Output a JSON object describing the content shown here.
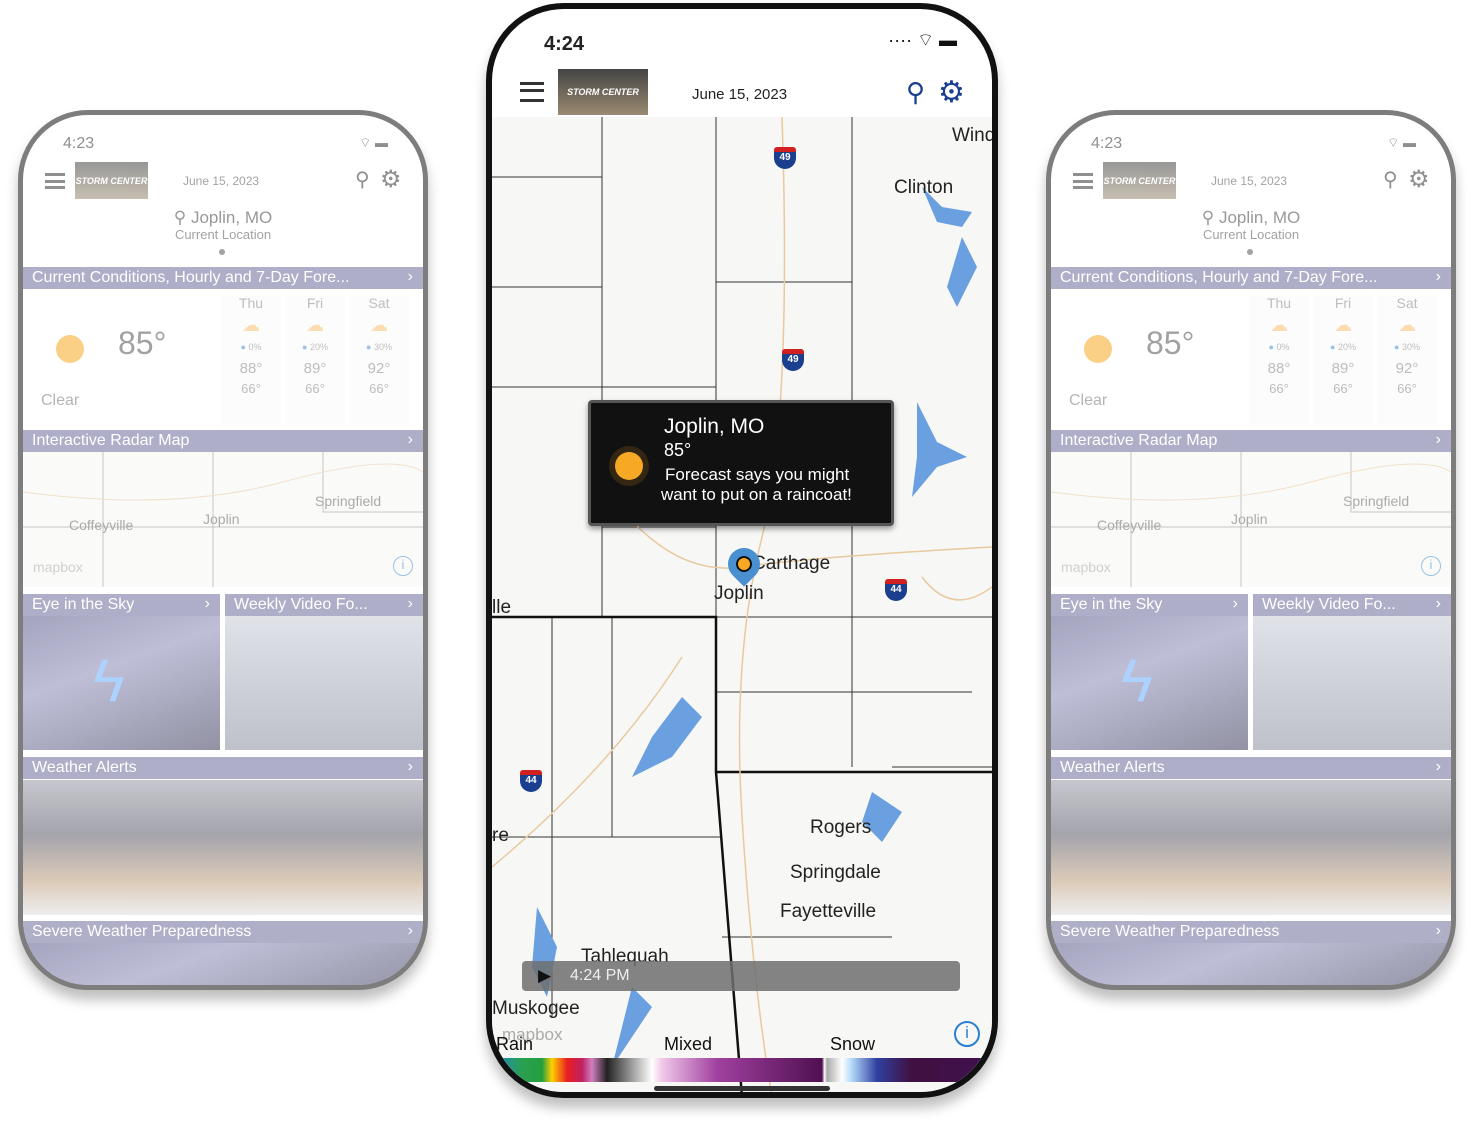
{
  "side_phone": {
    "time": "4:23",
    "date": "June 15, 2023",
    "logo": "STORM CENTER",
    "location": "Joplin, MO",
    "location_sub": "Current Location",
    "sections": {
      "conditions": "Current Conditions, Hourly and 7-Day Fore...",
      "radar": "Interactive Radar Map",
      "eye": "Eye in the Sky",
      "video": "Weekly Video Fo...",
      "alerts": "Weather Alerts",
      "severe": "Severe Weather Preparedness"
    },
    "current": {
      "temp": "85°",
      "condition": "Clear"
    },
    "forecast": [
      {
        "day": "Thu",
        "precip": "0%",
        "high": "88°",
        "low": "66°"
      },
      {
        "day": "Fri",
        "precip": "20%",
        "high": "89°",
        "low": "66°"
      },
      {
        "day": "Sat",
        "precip": "30%",
        "high": "92°",
        "low": "66°"
      }
    ],
    "map_labels": {
      "coffeyville": "Coffeyville",
      "joplin": "Joplin",
      "springfield": "Springfield",
      "attribution": "mapbox"
    }
  },
  "center_phone": {
    "time": "4:24",
    "date": "June 15, 2023",
    "logo": "STORM CENTER",
    "popup": {
      "city": "Joplin, MO",
      "temp": "85°",
      "line1": "Forecast says you might",
      "line2": "want to put on a raincoat!"
    },
    "map_labels": {
      "wind": "Wind",
      "clinton": "Clinton",
      "carthage": "Carthage",
      "joplin": "Joplin",
      "lle": "lle",
      "re": "re",
      "rogers": "Rogers",
      "springdale": "Springdale",
      "fayetteville": "Fayetteville",
      "tahlequah": "Tahlequah",
      "muskogee": "Muskogee",
      "attribution": "mapbox"
    },
    "shields": [
      "49",
      "49",
      "44",
      "44"
    ],
    "timeline": {
      "time": "4:24 PM"
    },
    "legend": {
      "rain": "Rain",
      "mixed": "Mixed",
      "snow": "Snow"
    }
  },
  "colors": {
    "section_bar": "#6d6d9c",
    "accent_blue": "#1a3f8f",
    "sun": "#f7a825"
  }
}
